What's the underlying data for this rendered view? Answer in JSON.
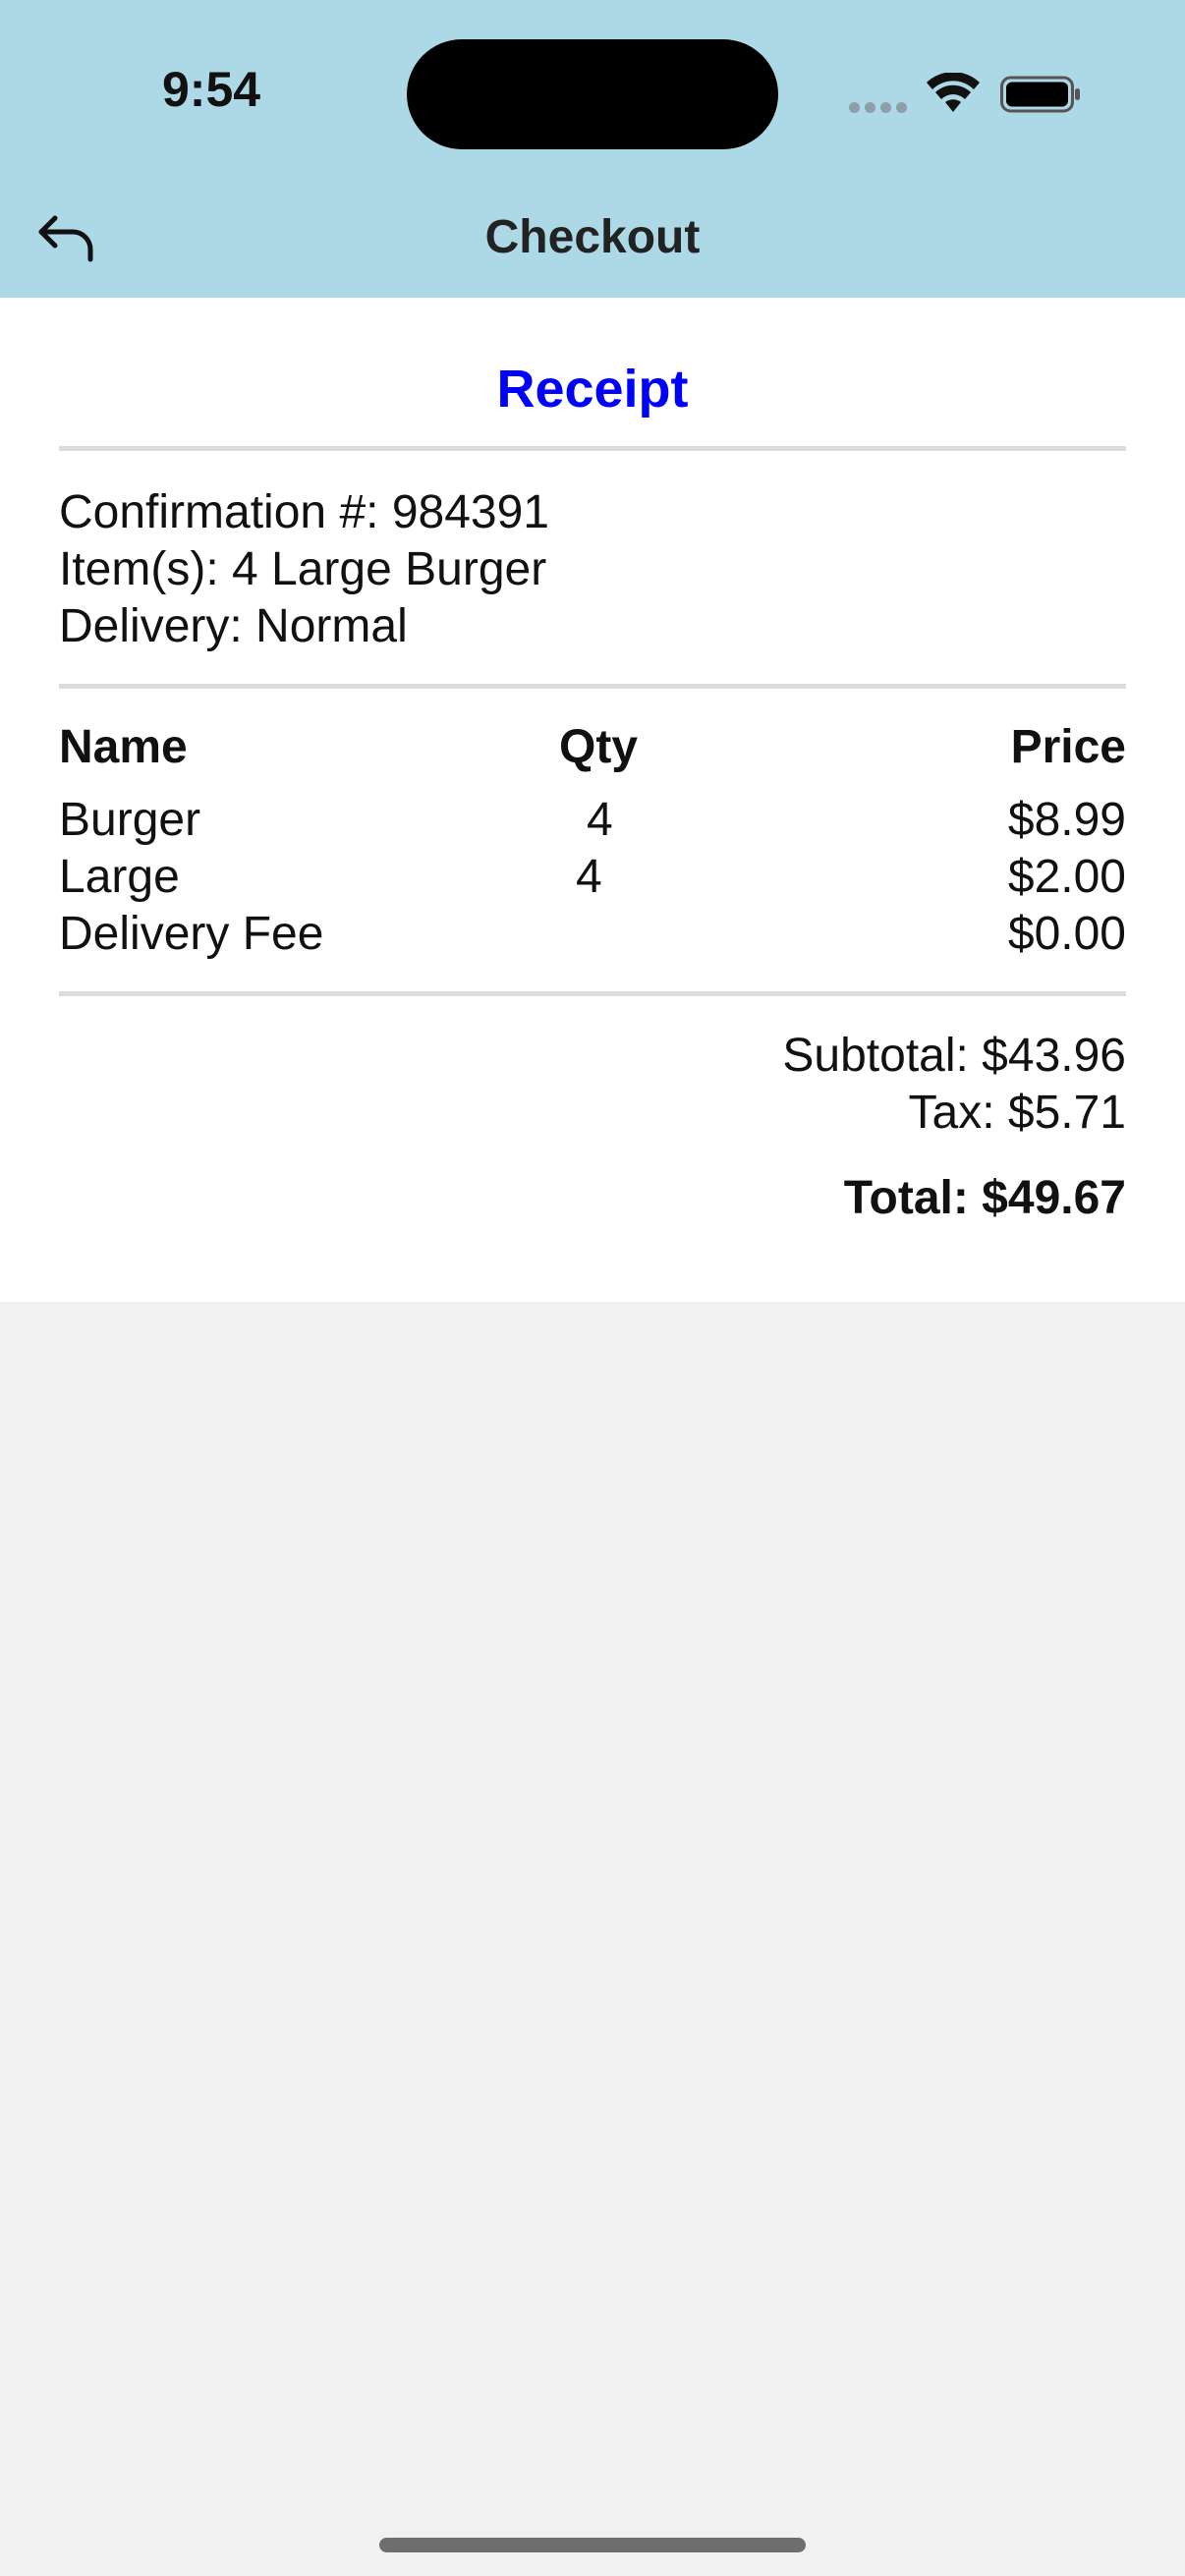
{
  "status_bar": {
    "time": "9:54"
  },
  "nav": {
    "title": "Checkout",
    "back_icon": "back-arrow-icon"
  },
  "receipt": {
    "title": "Receipt",
    "confirmation": "Confirmation #: 984391",
    "items": "Item(s): 4 Large Burger",
    "delivery": "Delivery: Normal",
    "columns": [
      "Name",
      "Qty",
      "Price"
    ],
    "rows": [
      {
        "name": "Burger",
        "qty": "4",
        "price": "$8.99"
      },
      {
        "name": "Large",
        "qty": "4",
        "price": "$2.00"
      },
      {
        "name": "Delivery Fee",
        "qty": "",
        "price": "$0.00"
      }
    ],
    "subtotal": "Subtotal: $43.96",
    "tax": "Tax: $5.71",
    "total": "Total: $49.67"
  },
  "colors": {
    "header_bg": "#add8e6",
    "receipt_title": "#0000ff",
    "page_bg": "#f1f1f1",
    "card_bg": "#ffffff"
  }
}
